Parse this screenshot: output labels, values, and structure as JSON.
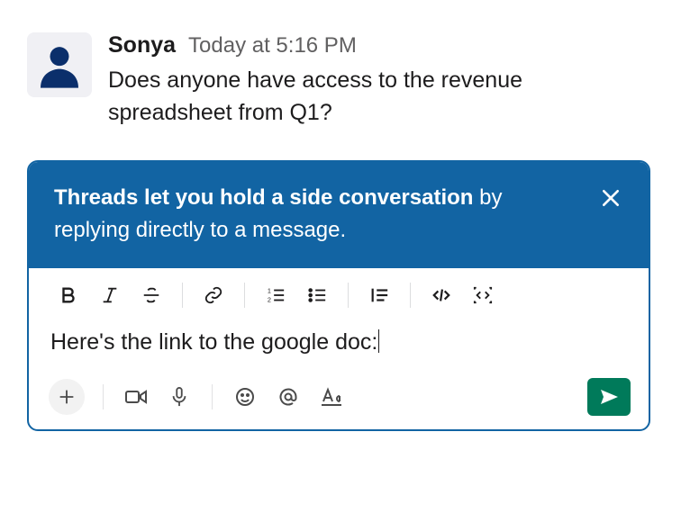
{
  "message": {
    "user": "Sonya",
    "timestamp": "Today at 5:16 PM",
    "text": "Does anyone have access to the revenue spreadsheet from Q1?"
  },
  "banner": {
    "bold": "Threads let you hold a side conversation",
    "rest": " by replying directly to a message."
  },
  "composer": {
    "draft": "Here's the link to the google doc:"
  },
  "icons": {
    "bold": "bold-icon",
    "italic": "italic-icon",
    "strike": "strikethrough-icon",
    "link": "link-icon",
    "ol": "ordered-list-icon",
    "ul": "bullet-list-icon",
    "quote": "blockquote-icon",
    "code": "code-icon",
    "codeblock": "code-block-icon",
    "plus": "plus-icon",
    "video": "video-icon",
    "mic": "microphone-icon",
    "emoji": "emoji-icon",
    "mention": "mention-icon",
    "format": "format-text-icon",
    "send": "send-icon",
    "close": "close-icon"
  }
}
